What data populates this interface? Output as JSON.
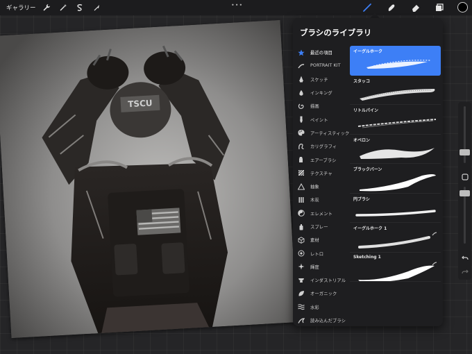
{
  "topbar": {
    "gallery_label": "ギャラリー",
    "left_tools": [
      {
        "name": "wrench-icon"
      },
      {
        "name": "magic-wand-icon"
      },
      {
        "name": "selection-s-icon"
      },
      {
        "name": "arrow-cursor-icon"
      }
    ],
    "dots": "•••",
    "right_tools": [
      {
        "name": "brush-icon",
        "active": true
      },
      {
        "name": "smudge-icon",
        "active": false
      },
      {
        "name": "eraser-icon",
        "active": false
      },
      {
        "name": "layers-icon",
        "active": false
      }
    ],
    "current_color": "#000000"
  },
  "accent_color": "#3d7ff6",
  "library": {
    "title": "ブラシのライブラリ",
    "categories": [
      {
        "label": "最近の項目",
        "icon": "star-icon",
        "active": true
      },
      {
        "label": "PORTRAIT KIT",
        "icon": "pen-stroke-icon"
      },
      {
        "label": "スケッチ",
        "icon": "pencil-tip-icon"
      },
      {
        "label": "インキング",
        "icon": "ink-drop-icon"
      },
      {
        "label": "描画",
        "icon": "spiral-icon"
      },
      {
        "label": "ペイント",
        "icon": "paint-brush-icon"
      },
      {
        "label": "アーティスティック",
        "icon": "palette-icon"
      },
      {
        "label": "カリグラフィ",
        "icon": "calligraphy-icon"
      },
      {
        "label": "エアーブラシ",
        "icon": "airbrush-icon"
      },
      {
        "label": "テクスチャ",
        "icon": "texture-icon"
      },
      {
        "label": "抽象",
        "icon": "triangle-icon"
      },
      {
        "label": "木炭",
        "icon": "charcoal-icon"
      },
      {
        "label": "エレメント",
        "icon": "yin-yang-icon"
      },
      {
        "label": "スプレー",
        "icon": "spray-can-icon"
      },
      {
        "label": "素材",
        "icon": "cube-icon"
      },
      {
        "label": "レトロ",
        "icon": "retro-circle-icon"
      },
      {
        "label": "輝度",
        "icon": "sparkle-icon"
      },
      {
        "label": "インダストリアル",
        "icon": "anvil-icon"
      },
      {
        "label": "オーガニック",
        "icon": "leaf-icon"
      },
      {
        "label": "水彩",
        "icon": "waves-icon"
      },
      {
        "label": "読み込んだブラシ",
        "icon": "imported-stroke-icon"
      }
    ],
    "brushes": [
      {
        "name": "イーグルホーク",
        "selected": true,
        "imported": false
      },
      {
        "name": "スタッコ",
        "selected": false,
        "imported": false
      },
      {
        "name": "リトルパイン",
        "selected": false,
        "imported": false
      },
      {
        "name": "オベロン",
        "selected": false,
        "imported": false
      },
      {
        "name": "ブラックバーン",
        "selected": false,
        "imported": false
      },
      {
        "name": "円ブラシ",
        "selected": false,
        "imported": false
      },
      {
        "name": "イーグルホーク 1",
        "selected": false,
        "imported": true
      },
      {
        "name": "Sketching 1",
        "selected": false,
        "imported": true
      }
    ]
  }
}
